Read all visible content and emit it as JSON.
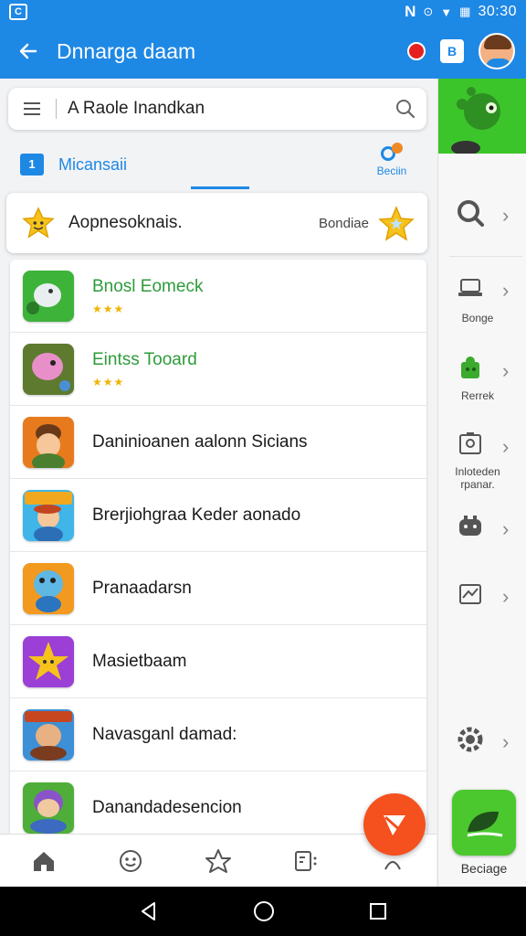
{
  "status_bar": {
    "app_icon": "C",
    "notification": "N",
    "icons": [
      "wifi-icon",
      "signal-icon",
      "battery-icon"
    ],
    "time": "30:30"
  },
  "app_bar": {
    "title": "Dnnarga daam",
    "square_button": "B"
  },
  "search": {
    "text": "A Raole Inandkan"
  },
  "section": {
    "icon_text": "1",
    "label": "Micansaii",
    "right_label": "Beciin"
  },
  "featured": {
    "title": "Aopnesoknais.",
    "subtitle": "Bondiae"
  },
  "list": [
    {
      "title": "Bnosl Eomeck",
      "green": true,
      "stars": "★★★"
    },
    {
      "title": "Eintss Tooard",
      "green": true,
      "stars": "★★★"
    },
    {
      "title": "Daninioanen aalonn Sicians",
      "green": false,
      "stars": ""
    },
    {
      "title": "Brerjiohgraa Keder aonado",
      "green": false,
      "stars": ""
    },
    {
      "title": "Pranaadarsn",
      "green": false,
      "stars": ""
    },
    {
      "title": "Masietbaam",
      "green": false,
      "stars": ""
    },
    {
      "title": "Navasganl damad:",
      "green": false,
      "stars": ""
    },
    {
      "title": "Danandadesencion",
      "green": false,
      "stars": ""
    }
  ],
  "right_panel": {
    "items": [
      {
        "icon": "search-icon",
        "label": ""
      },
      {
        "icon": "laptop-icon",
        "label": "Bonge"
      },
      {
        "icon": "puzzle-icon",
        "label": "Rerrek"
      },
      {
        "icon": "image-icon",
        "label": "Inloteden rpanar."
      },
      {
        "icon": "controller-icon",
        "label": ""
      },
      {
        "icon": "chart-icon",
        "label": ""
      },
      {
        "icon": "settings-icon",
        "label": ""
      }
    ],
    "bottom_app_label": "Beciage"
  },
  "colors": {
    "primary": "#1e88e5",
    "accent": "#f4511e",
    "green": "#2e9b3a"
  }
}
